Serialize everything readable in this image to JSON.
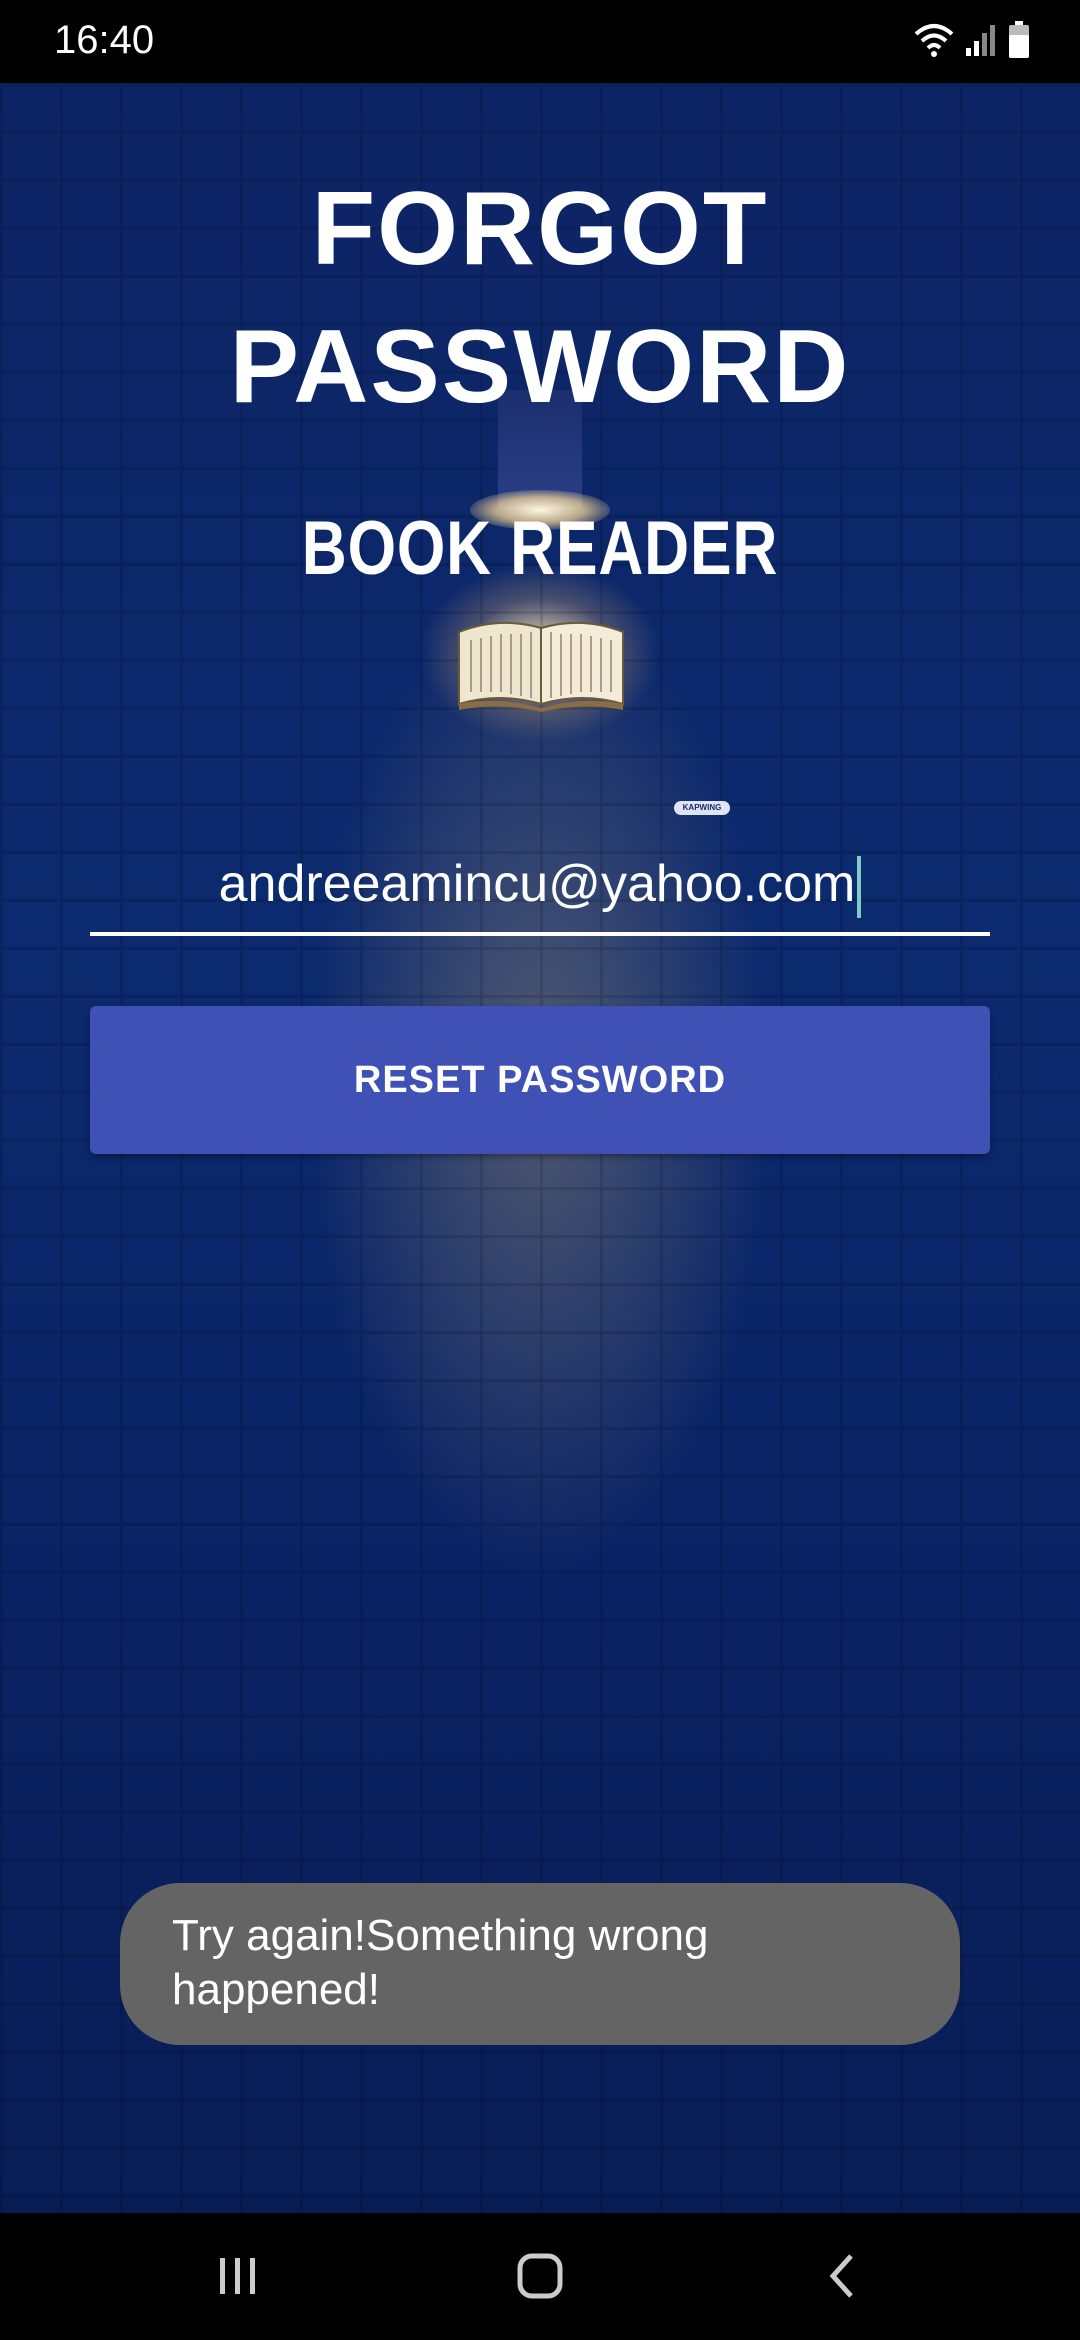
{
  "status_bar": {
    "time": "16:40",
    "icons": [
      "wifi-icon",
      "signal-icon",
      "battery-icon"
    ]
  },
  "header": {
    "title_line1": "FORGOT",
    "title_line2": "PASSWORD",
    "app_name": "BOOK READER"
  },
  "watermark": {
    "text": "KAPWING"
  },
  "form": {
    "email_value": "andreeamincu@yahoo.com",
    "reset_button_label": "RESET PASSWORD"
  },
  "toast": {
    "message": "Try again!Something wrong happened!"
  },
  "nav_bar": {
    "items": [
      "recent-apps-icon",
      "home-icon",
      "back-icon"
    ]
  },
  "colors": {
    "button": "#3f51b5",
    "background": "#0c2a6f",
    "toast": "#646464",
    "cursor": "#80cbc4"
  }
}
